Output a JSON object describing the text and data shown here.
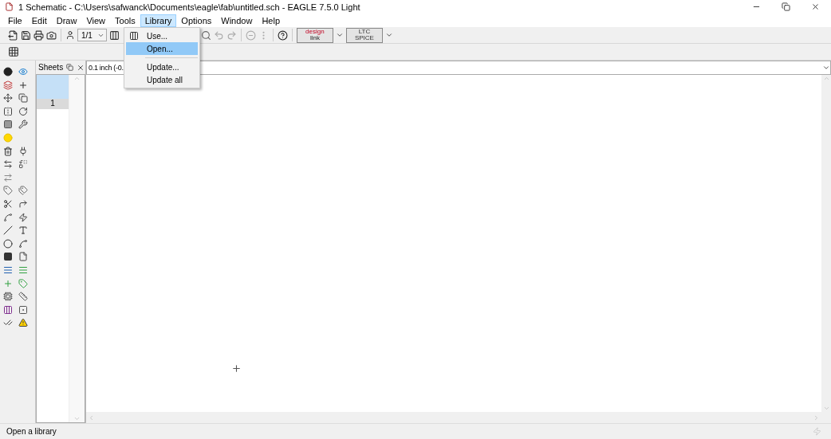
{
  "window": {
    "title": "1 Schematic - C:\\Users\\safwanck\\Documents\\eagle\\fab\\untitled.sch - EAGLE 7.5.0 Light"
  },
  "menu_bar": [
    {
      "label": "File",
      "selected": false
    },
    {
      "label": "Edit",
      "selected": false
    },
    {
      "label": "Draw",
      "selected": false
    },
    {
      "label": "View",
      "selected": false
    },
    {
      "label": "Tools",
      "selected": false
    },
    {
      "label": "Library",
      "selected": true
    },
    {
      "label": "Options",
      "selected": false
    },
    {
      "label": "Window",
      "selected": false
    },
    {
      "label": "Help",
      "selected": false
    }
  ],
  "library_menu": {
    "items": [
      {
        "kind": "item",
        "label": "Use...",
        "selected": false
      },
      {
        "kind": "item",
        "label": "Open...",
        "selected": true
      },
      {
        "kind": "separator"
      },
      {
        "kind": "item",
        "label": "Update...",
        "selected": false
      },
      {
        "kind": "item",
        "label": "Update all",
        "selected": false
      }
    ]
  },
  "toolbar": {
    "sheet_select": "1/1",
    "design_link_logo": {
      "line_1": "design",
      "line_2": "link"
    },
    "ltc_spice_logo": {
      "line_1": "LTC",
      "line_2": "SPICE"
    }
  },
  "sheets_panel": {
    "title": "Sheets",
    "sheets": [
      {
        "label": "1",
        "selected": true
      }
    ]
  },
  "coordinates": "0.1 inch (-0.",
  "status_bar": {
    "text": "Open a library"
  }
}
